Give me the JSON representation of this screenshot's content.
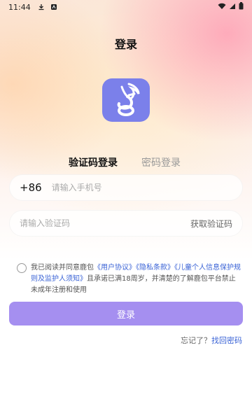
{
  "status_bar": {
    "time": "11:44"
  },
  "page": {
    "title": "登录"
  },
  "tabs": [
    {
      "label": "验证码登录",
      "active": true
    },
    {
      "label": "密码登录",
      "active": false
    }
  ],
  "phone": {
    "country_code": "+86",
    "placeholder": "请输入手机号",
    "value": ""
  },
  "verification": {
    "placeholder": "请输入验证码",
    "value": "",
    "get_code_label": "获取验证码"
  },
  "agreement": {
    "checked": false,
    "prefix": "我已阅读并同意鹿包",
    "user_agreement": "《用户协议》",
    "privacy_policy": "《隐私条款》",
    "child_policy": "《儿童个人信息保护规则及监护人须知》",
    "suffix": "且承诺已满18周岁，并清楚的了解鹿包平台禁止未成年注册和使用"
  },
  "login_button": {
    "label": "登录"
  },
  "forgot": {
    "prompt": "忘记了？",
    "link": "找回密码"
  },
  "colors": {
    "accent": "#a58ff0",
    "logo_bg": "#7b80ea",
    "link": "#3a63d6"
  }
}
